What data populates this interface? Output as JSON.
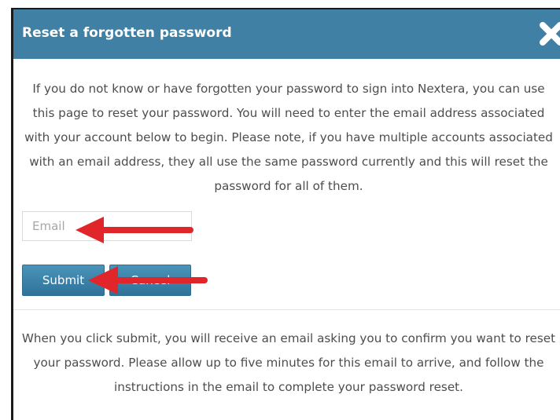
{
  "dialog": {
    "title": "Reset a forgotten password",
    "close_icon": "close-icon",
    "intro_text": "If you do not know or have forgotten your password to sign into Nextera, you can use this page to reset your password. You will need to enter the email address associated with your account below to begin. Please note, if you have multiple accounts associated with an email address, they all use the same password currently and this will reset the password for all of them.",
    "email": {
      "placeholder": "Email",
      "value": ""
    },
    "buttons": {
      "submit_label": "Submit",
      "cancel_label": "Cancel"
    },
    "outro_text": "When you click submit, you will receive an email asking you to confirm you want to reset your password. Please allow up to five minutes for this email to arrive, and follow the instructions in the email to complete your password reset."
  },
  "annotations": {
    "arrow_icon": "arrow-left-icon",
    "arrow_color": "#e0262b"
  },
  "colors": {
    "titlebar": "#3f80a4",
    "button": "#3a82aa",
    "text": "#4d4d4d"
  }
}
